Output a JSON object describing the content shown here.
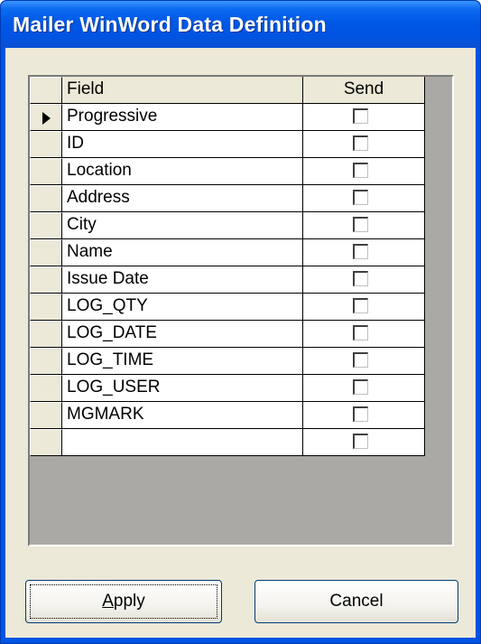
{
  "window": {
    "title": "Mailer WinWord Data Definition"
  },
  "grid": {
    "columns": [
      "Field",
      "Send"
    ],
    "current_row_index": 0,
    "rows": [
      {
        "field": "Progressive",
        "send": false
      },
      {
        "field": "ID",
        "send": false
      },
      {
        "field": "Location",
        "send": false
      },
      {
        "field": "Address",
        "send": false
      },
      {
        "field": "City",
        "send": false
      },
      {
        "field": "Name",
        "send": false
      },
      {
        "field": "Issue Date",
        "send": false
      },
      {
        "field": "LOG_QTY",
        "send": false
      },
      {
        "field": "LOG_DATE",
        "send": false
      },
      {
        "field": "LOG_TIME",
        "send": false
      },
      {
        "field": "LOG_USER",
        "send": false
      },
      {
        "field": "MGMARK",
        "send": false
      },
      {
        "field": "",
        "send": false
      }
    ]
  },
  "buttons": {
    "apply": {
      "accel": "A",
      "rest": "pply"
    },
    "cancel": "Cancel"
  },
  "colors": {
    "titlebar": "#0054e3",
    "dialog_bg": "#ece9d8",
    "grid_bg": "#aba9a6"
  }
}
